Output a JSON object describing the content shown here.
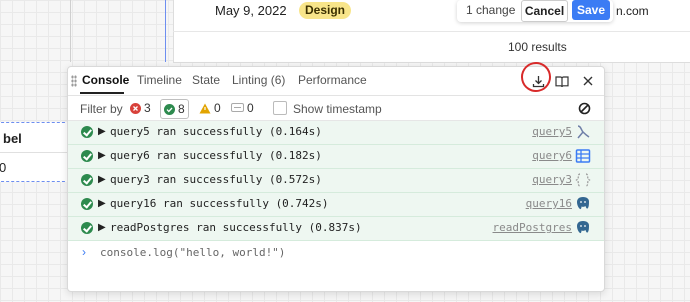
{
  "table": {
    "row_date": "May 9, 2022",
    "row_tag": "Design",
    "email_tail": "n.com",
    "results": "100 results"
  },
  "change_bar": {
    "text": "1 change",
    "cancel_label": "Cancel",
    "save_label": "Save"
  },
  "left_card": {
    "header": "bel",
    "value": "0"
  },
  "console": {
    "tabs": [
      "Console",
      "Timeline",
      "State",
      "Linting (6)",
      "Performance"
    ],
    "active_tab": "Console",
    "filter": {
      "label": "Filter by",
      "errors_count": "3",
      "success_count": "8",
      "warnings_count": "0",
      "info_count": "0",
      "show_timestamp_label": "Show timestamp"
    },
    "logs": [
      {
        "message": "query5 ran successfully (0.164s)",
        "link": "query5",
        "resource_icon": "rest-api-icon"
      },
      {
        "message": "query6 ran successfully (0.182s)",
        "link": "query6",
        "resource_icon": "table-icon"
      },
      {
        "message": "query3 ran successfully (0.572s)",
        "link": "query3",
        "resource_icon": "javascript-icon"
      },
      {
        "message": "query16 ran successfully (0.742s)",
        "link": "query16",
        "resource_icon": "postgres-icon"
      },
      {
        "message": "readPostgres ran successfully (0.837s)",
        "link": "readPostgres",
        "resource_icon": "postgres-icon"
      }
    ],
    "prompt_text": "console.log(\"hello, world!\")"
  },
  "colors": {
    "accent": "#3b7cf4",
    "success": "#2d8a4e",
    "error": "#d8413a",
    "warning": "#e2a400",
    "annotation": "#d82a2a"
  }
}
